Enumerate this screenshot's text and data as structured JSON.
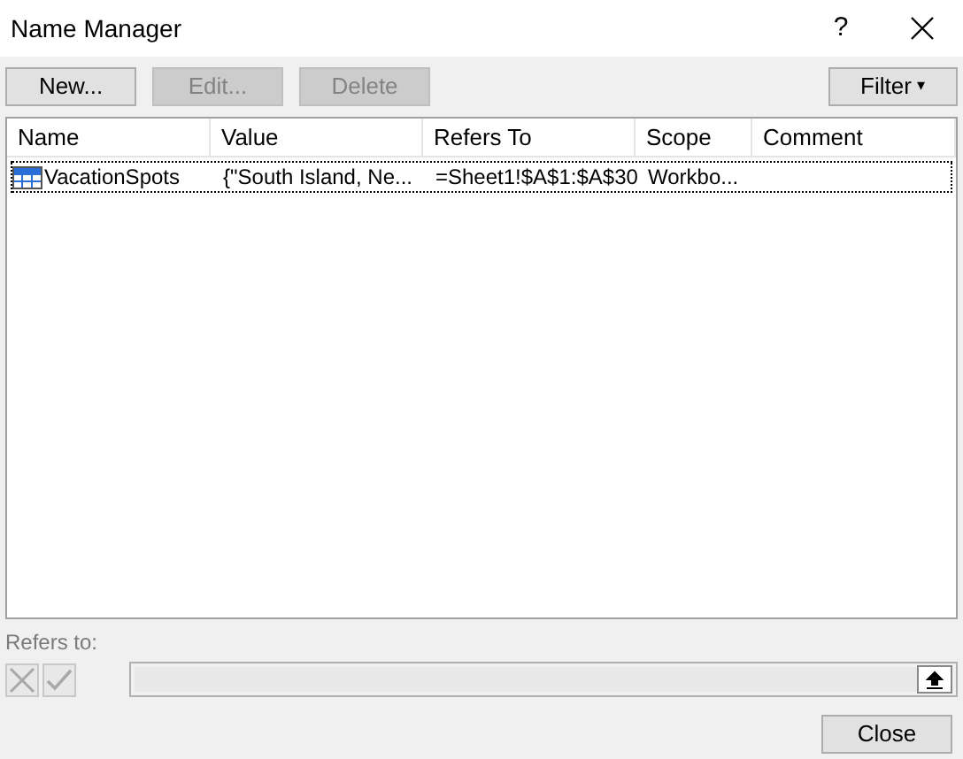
{
  "window": {
    "title": "Name Manager",
    "help": "?"
  },
  "buttons": [
    {
      "label": "New...",
      "disabled": false
    },
    {
      "label": "Edit...",
      "disabled": true
    },
    {
      "label": "Delete",
      "disabled": true
    }
  ],
  "filter_button": {
    "label": "Filter",
    "caret": "▾"
  },
  "table": {
    "columns": [
      "Name",
      "Value",
      "Refers To",
      "Scope",
      "Comment"
    ],
    "rows": [
      {
        "cells": [
          "VacationSpots",
          "{\"South Island, Ne...",
          "=Sheet1!$A$1:$A$30",
          "Workbo...",
          ""
        ],
        "selected": true
      }
    ]
  },
  "refers_to": {
    "label": "Refers to:",
    "disabled": true
  },
  "close_button": {
    "label": "Close"
  }
}
